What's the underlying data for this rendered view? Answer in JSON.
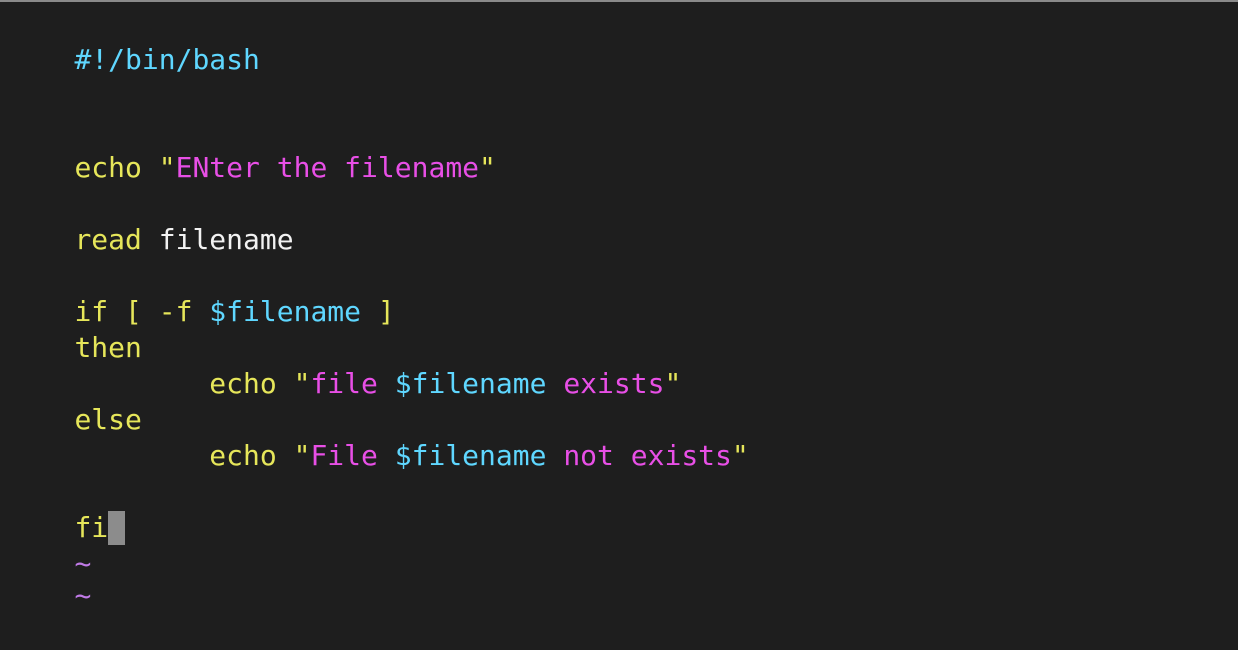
{
  "editor": {
    "colors": {
      "background": "#1e1e1e",
      "keyword": "#e6e65a",
      "string": "#e84fe6",
      "variable": "#5fd7ff",
      "plain": "#f2f2f2",
      "tilde": "#c07ae6",
      "cursor": "#8c8c8c"
    },
    "lines": [
      {
        "tokens": [
          {
            "t": "#!/bin/bash",
            "k": "shebang"
          }
        ]
      },
      {
        "tokens": [
          {
            "t": "echo",
            "k": "kw"
          },
          {
            "t": " ",
            "k": "plain"
          },
          {
            "t": "\"",
            "k": "kw"
          },
          {
            "t": "ENter the filename",
            "k": "str"
          },
          {
            "t": "\"",
            "k": "kw"
          }
        ]
      },
      {
        "tokens": [
          {
            "t": "read",
            "k": "kw"
          },
          {
            "t": " filename",
            "k": "plain"
          }
        ]
      },
      {
        "tokens": [
          {
            "t": "if [ -f ",
            "k": "kw"
          },
          {
            "t": "$filename",
            "k": "var"
          },
          {
            "t": " ]",
            "k": "kw"
          }
        ]
      },
      {
        "tokens": [
          {
            "t": "then",
            "k": "kw"
          }
        ]
      },
      {
        "tokens": [
          {
            "t": "        echo",
            "k": "kw"
          },
          {
            "t": " ",
            "k": "plain"
          },
          {
            "t": "\"",
            "k": "kw"
          },
          {
            "t": "file ",
            "k": "str"
          },
          {
            "t": "$filename",
            "k": "var"
          },
          {
            "t": " exists",
            "k": "str"
          },
          {
            "t": "\"",
            "k": "kw"
          }
        ]
      },
      {
        "tokens": [
          {
            "t": "else",
            "k": "kw"
          }
        ]
      },
      {
        "tokens": [
          {
            "t": "        echo",
            "k": "kw"
          },
          {
            "t": " ",
            "k": "plain"
          },
          {
            "t": "\"",
            "k": "kw"
          },
          {
            "t": "File ",
            "k": "str"
          },
          {
            "t": "$filename",
            "k": "var"
          },
          {
            "t": " not exists",
            "k": "str"
          },
          {
            "t": "\"",
            "k": "kw"
          }
        ]
      },
      {
        "tokens": [
          {
            "t": "fi",
            "k": "kw"
          }
        ]
      },
      {
        "tokens": [
          {
            "t": "~",
            "k": "tilde"
          }
        ]
      },
      {
        "tokens": [
          {
            "t": "~",
            "k": "tilde"
          }
        ]
      }
    ]
  }
}
